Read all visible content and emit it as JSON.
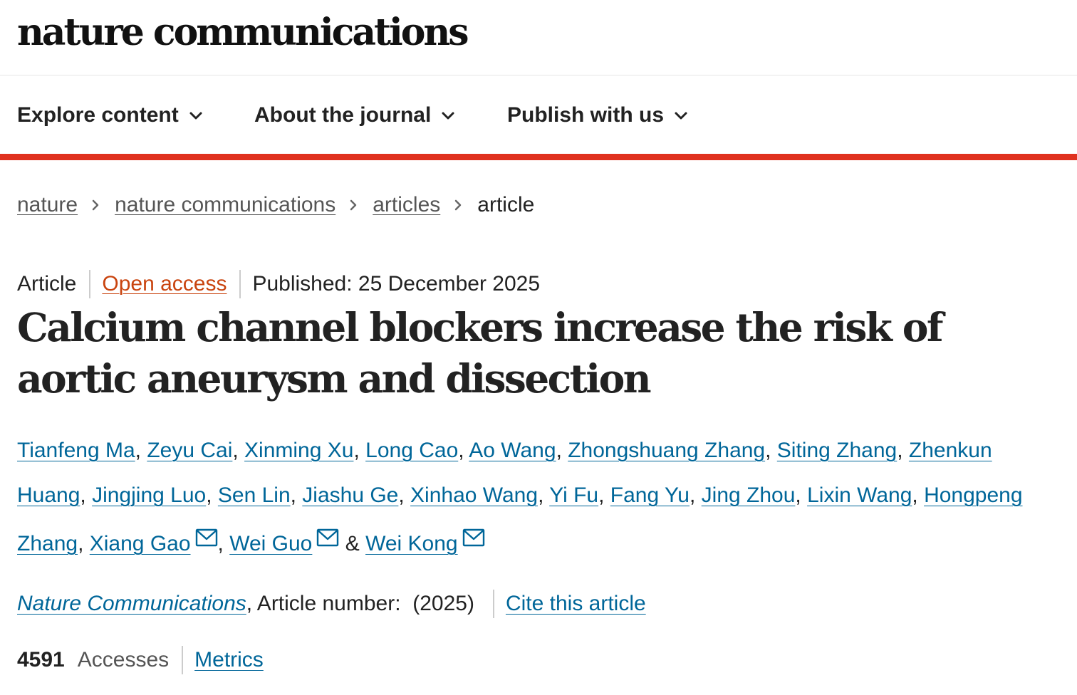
{
  "header": {
    "brand": "nature communications"
  },
  "nav": {
    "items": [
      {
        "label": "Explore content"
      },
      {
        "label": "About the journal"
      },
      {
        "label": "Publish with us"
      }
    ]
  },
  "breadcrumb": {
    "items": [
      {
        "label": "nature"
      },
      {
        "label": "nature communications"
      },
      {
        "label": "articles"
      }
    ],
    "current": "article"
  },
  "article": {
    "type": "Article",
    "access": "Open access",
    "published": "Published: 25 December 2025",
    "title": "Calcium channel blockers increase the risk of aortic aneurysm and dissection",
    "authors": [
      {
        "name": "Tianfeng Ma"
      },
      {
        "name": "Zeyu Cai"
      },
      {
        "name": "Xinming Xu"
      },
      {
        "name": "Long Cao"
      },
      {
        "name": "Ao Wang"
      },
      {
        "name": "Zhongshuang Zhang"
      },
      {
        "name": "Siting Zhang"
      },
      {
        "name": "Zhenkun Huang"
      },
      {
        "name": "Jingjing Luo"
      },
      {
        "name": "Sen Lin"
      },
      {
        "name": "Jiashu Ge"
      },
      {
        "name": "Xinhao Wang"
      },
      {
        "name": "Yi Fu"
      },
      {
        "name": "Fang Yu"
      },
      {
        "name": "Jing Zhou"
      },
      {
        "name": "Lixin Wang"
      },
      {
        "name": "Hongpeng Zhang"
      },
      {
        "name": "Xiang Gao",
        "email_icon": "mail-icon"
      },
      {
        "name": "Wei Guo",
        "email_icon": "mail-icon"
      },
      {
        "name": "Wei Kong",
        "email_icon": "mail-icon"
      }
    ],
    "author_separator": ", ",
    "author_last_separator": " & ",
    "journal": "Nature Communications",
    "article_number": ", Article number:  (2025)",
    "cite": "Cite this article",
    "accesses_count": "4591",
    "accesses_label": "Accesses",
    "metrics": "Metrics"
  },
  "colors": {
    "accent_bar": "#e0311f",
    "link": "#006699",
    "open_access": "#c9440f",
    "text": "#222222",
    "muted": "#555555"
  },
  "icons": {
    "nav_dropdown": "chevron-down-icon",
    "breadcrumb_separator": "chevron-right-icon",
    "author_contact": "mail-icon"
  }
}
